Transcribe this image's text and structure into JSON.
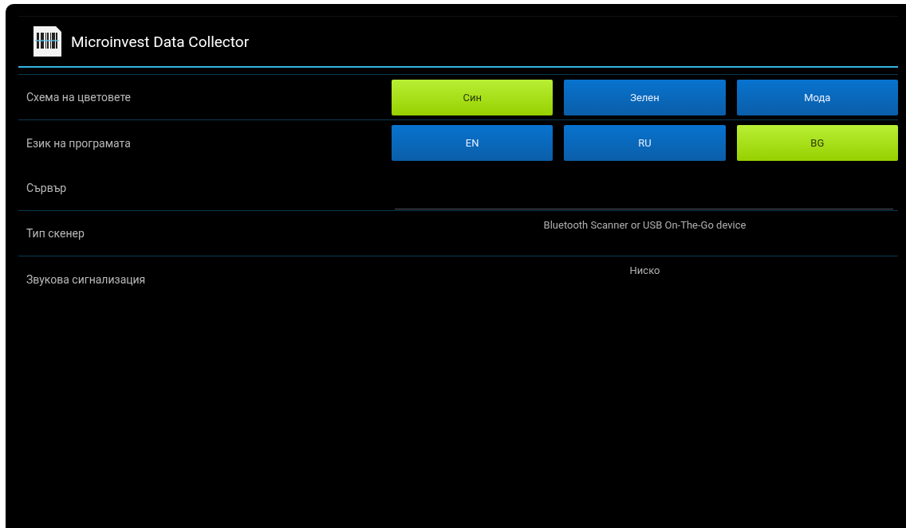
{
  "app_bar": {
    "title": "Microinvest Data Collector"
  },
  "settings": [
    {
      "kind": "options",
      "label": "Схема на цветовете",
      "options": [
        {
          "label": "Син",
          "selected": true
        },
        {
          "label": "Зелен",
          "selected": false
        },
        {
          "label": "Мода",
          "selected": false
        }
      ]
    },
    {
      "kind": "options",
      "label": "Език на програмата",
      "options": [
        {
          "label": "EN",
          "selected": false
        },
        {
          "label": "RU",
          "selected": false
        },
        {
          "label": "BG",
          "selected": true
        }
      ]
    },
    {
      "kind": "field",
      "label": "Сървър"
    },
    {
      "kind": "value",
      "label": "Тип скенер",
      "value": "Bluetooth Scanner or USB On-The-Go device"
    },
    {
      "kind": "value",
      "label": "Звукова сигнализация",
      "value": "Ниско"
    }
  ]
}
